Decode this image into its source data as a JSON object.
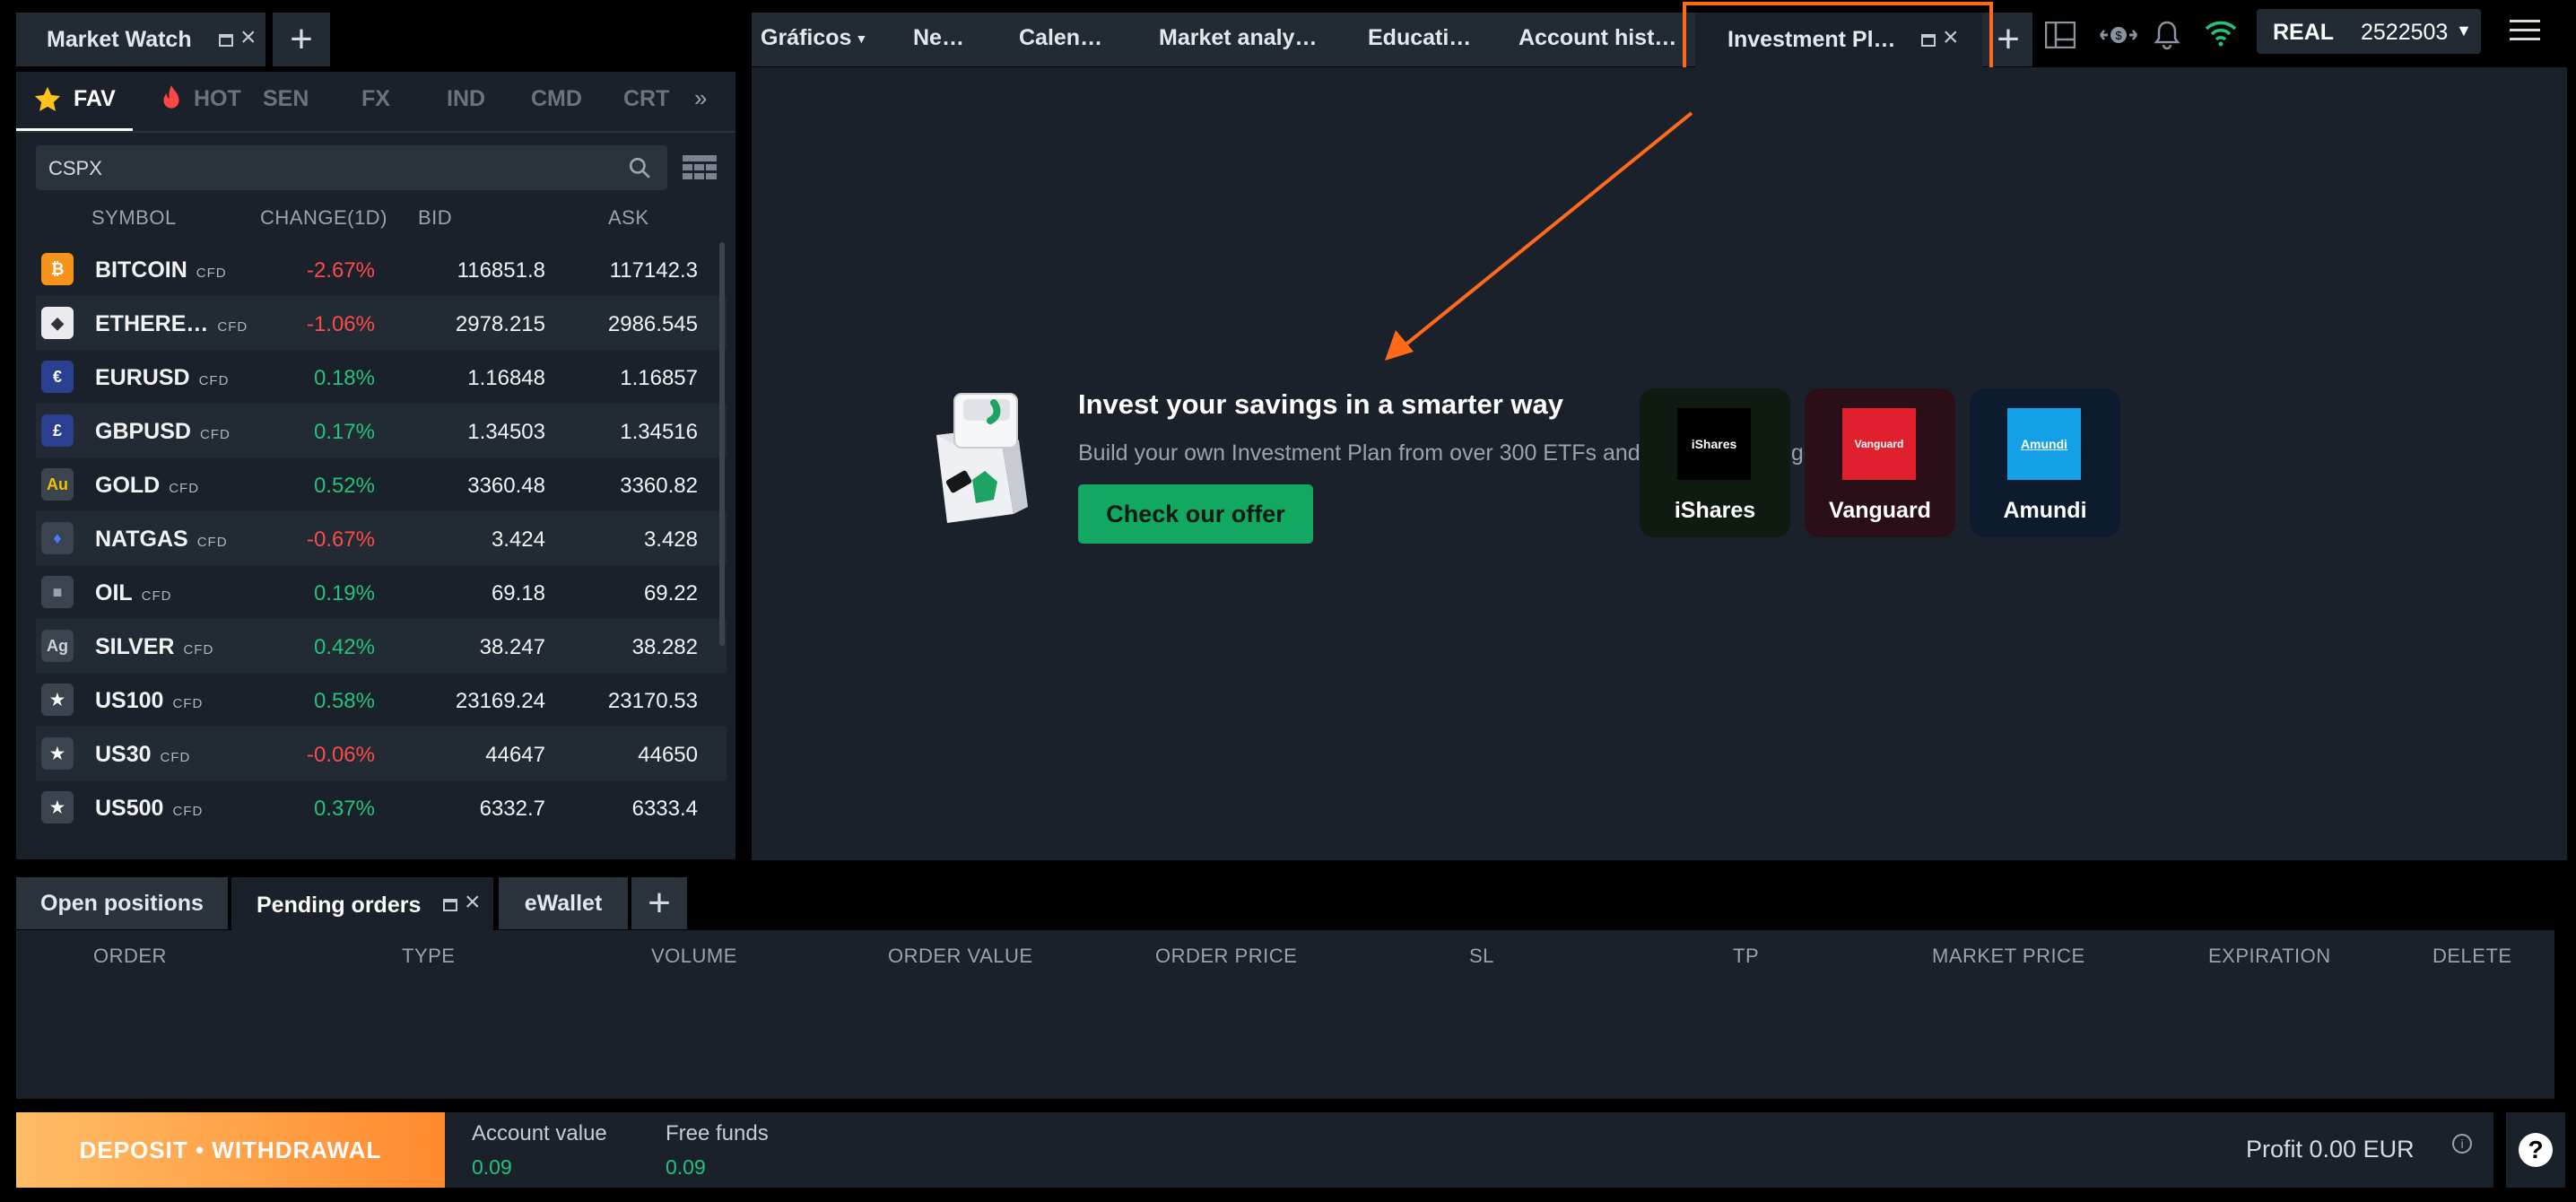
{
  "market_watch": {
    "title": "Market Watch",
    "categories": [
      {
        "label": "FAV",
        "icon": "star-icon"
      },
      {
        "label": "HOT",
        "icon": "fire-icon"
      },
      {
        "label": "SEN"
      },
      {
        "label": "FX"
      },
      {
        "label": "IND"
      },
      {
        "label": "CMD"
      },
      {
        "label": "CRT"
      }
    ],
    "search_value": "CSPX",
    "columns": [
      "SYMBOL",
      "CHANGE(1D)",
      "BID",
      "ASK"
    ],
    "cfd_badge": "CFD",
    "rows": [
      {
        "symbol": "BITCOIN",
        "change": "-2.67%",
        "bid": "116851.8",
        "ask": "117142.3",
        "icon": "bitcoin-icon"
      },
      {
        "symbol": "ETHERE…",
        "change": "-1.06%",
        "bid": "2978.215",
        "ask": "2986.545",
        "icon": "ethereum-icon"
      },
      {
        "symbol": "EURUSD",
        "change": "0.18%",
        "bid": "1.16848",
        "ask": "1.16857",
        "icon": "eu-us-flag-icon"
      },
      {
        "symbol": "GBPUSD",
        "change": "0.17%",
        "bid": "1.34503",
        "ask": "1.34516",
        "icon": "uk-us-flag-icon"
      },
      {
        "symbol": "GOLD",
        "change": "0.52%",
        "bid": "3360.48",
        "ask": "3360.82",
        "icon": "gold-icon",
        "icon_text": "Au"
      },
      {
        "symbol": "NATGAS",
        "change": "-0.67%",
        "bid": "3.424",
        "ask": "3.428",
        "icon": "gas-flame-icon"
      },
      {
        "symbol": "OIL",
        "change": "0.19%",
        "bid": "69.18",
        "ask": "69.22",
        "icon": "oil-barrel-icon"
      },
      {
        "symbol": "SILVER",
        "change": "0.42%",
        "bid": "38.247",
        "ask": "38.282",
        "icon": "silver-icon",
        "icon_text": "Ag"
      },
      {
        "symbol": "US100",
        "change": "0.58%",
        "bid": "23169.24",
        "ask": "23170.53",
        "icon": "us-flag-icon"
      },
      {
        "symbol": "US30",
        "change": "-0.06%",
        "bid": "44647",
        "ask": "44650",
        "icon": "us-flag-icon"
      },
      {
        "symbol": "US500",
        "change": "0.37%",
        "bid": "6332.7",
        "ask": "6333.4",
        "icon": "us-flag-icon"
      }
    ]
  },
  "top_tabs": [
    "Gráficos",
    "Ne…",
    "Calen…",
    "Market analy…",
    "Educati…",
    "Account hist…",
    "Investment Pl…"
  ],
  "account": {
    "type": "REAL",
    "number": "2522503"
  },
  "invest": {
    "title": "Invest your savings in a smarter way",
    "subtitle": "Build your own Investment Plan from over 300 ETFs and achieve yours goals.",
    "button": "Check our offer",
    "brands": [
      {
        "name": "iShares",
        "logo": "iShares",
        "bg": "#0f1a10",
        "logo_bg": "#000000"
      },
      {
        "name": "Vanguard",
        "logo": "Vanguard",
        "bg": "#2b0f18",
        "logo_bg": "#e0202e"
      },
      {
        "name": "Amundi",
        "logo": "Amundi",
        "bg": "#0c1b2e",
        "logo_bg": "#13a0e6"
      }
    ]
  },
  "bottom_tabs": [
    "Open positions",
    "Pending orders",
    "eWallet"
  ],
  "orders_columns": [
    "ORDER",
    "TYPE",
    "VOLUME",
    "ORDER VALUE",
    "ORDER PRICE",
    "SL",
    "TP",
    "MARKET PRICE",
    "EXPIRATION",
    "DELETE"
  ],
  "footer": {
    "deposit_label": "DEPOSIT • WITHDRAWAL",
    "account_value_label": "Account value",
    "account_value": "0.09",
    "free_funds_label": "Free funds",
    "free_funds": "0.09",
    "profit": "Profit 0.00 EUR"
  },
  "colors": {
    "accent_orange": "#ff6a1a",
    "positive": "#26c27c",
    "negative": "#ff4a4a",
    "panel": "#1a212a"
  }
}
